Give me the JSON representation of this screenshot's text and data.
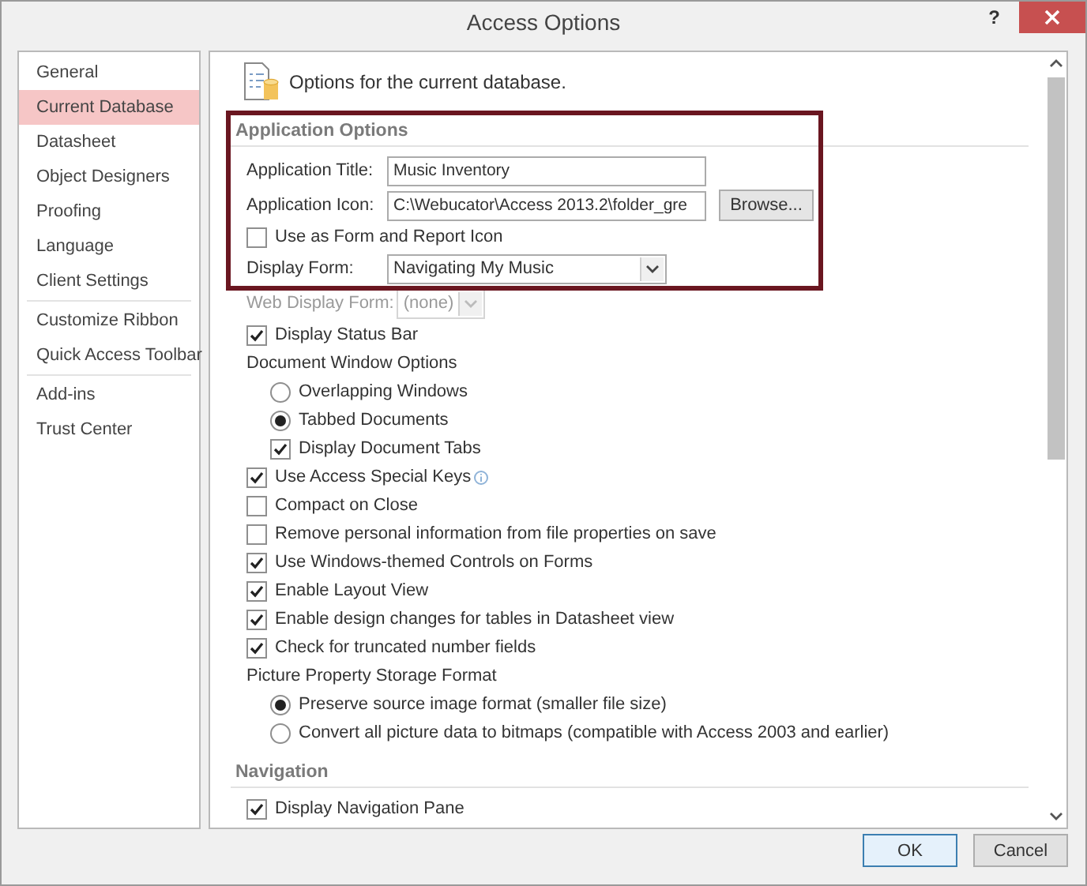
{
  "window": {
    "title": "Access Options",
    "help": "?"
  },
  "sidebar": {
    "groups": [
      {
        "items": [
          {
            "label": "General",
            "selected": false
          },
          {
            "label": "Current Database",
            "selected": true
          },
          {
            "label": "Datasheet",
            "selected": false
          },
          {
            "label": "Object Designers",
            "selected": false
          },
          {
            "label": "Proofing",
            "selected": false
          },
          {
            "label": "Language",
            "selected": false
          },
          {
            "label": "Client Settings",
            "selected": false
          }
        ]
      },
      {
        "items": [
          {
            "label": "Customize Ribbon",
            "selected": false
          },
          {
            "label": "Quick Access Toolbar",
            "selected": false
          }
        ]
      },
      {
        "items": [
          {
            "label": "Add-ins",
            "selected": false
          },
          {
            "label": "Trust Center",
            "selected": false
          }
        ]
      }
    ]
  },
  "content": {
    "header": "Options for the current database.",
    "sections": [
      {
        "title": "Application Options",
        "highlighted": true,
        "rows": [
          {
            "kind": "text_field",
            "label": "Application Title:",
            "value": "Music Inventory"
          },
          {
            "kind": "file_field",
            "label": "Application Icon:",
            "value": "C:\\Webucator\\Access 2013.2\\folder_gre",
            "button": "Browse..."
          },
          {
            "kind": "checkbox",
            "label": "Use as Form and Report Icon",
            "checked": false
          },
          {
            "kind": "dropdown",
            "label": "Display Form:",
            "value": "Navigating My Music",
            "disabled": false
          },
          {
            "kind": "dropdown",
            "label": "Web Display Form:",
            "value": "(none)",
            "disabled": true
          },
          {
            "kind": "checkbox",
            "label": "Display Status Bar",
            "checked": true
          },
          {
            "kind": "group",
            "label": "Document Window Options",
            "children": [
              {
                "kind": "radio",
                "label": "Overlapping Windows",
                "selected": false
              },
              {
                "kind": "radio",
                "label": "Tabbed Documents",
                "selected": true
              },
              {
                "kind": "checkbox",
                "label": "Display Document Tabs",
                "checked": true
              }
            ]
          },
          {
            "kind": "checkbox",
            "label": "Use Access Special Keys",
            "checked": true,
            "info": true
          },
          {
            "kind": "checkbox",
            "label": "Compact on Close",
            "checked": false
          },
          {
            "kind": "checkbox",
            "label": "Remove personal information from file properties on save",
            "checked": false
          },
          {
            "kind": "checkbox",
            "label": "Use Windows-themed Controls on Forms",
            "checked": true
          },
          {
            "kind": "checkbox",
            "label": "Enable Layout View",
            "checked": true
          },
          {
            "kind": "checkbox",
            "label": "Enable design changes for tables in Datasheet view",
            "checked": true
          },
          {
            "kind": "checkbox",
            "label": "Check for truncated number fields",
            "checked": true
          },
          {
            "kind": "group",
            "label": "Picture Property Storage Format",
            "children": [
              {
                "kind": "radio",
                "label": "Preserve source image format (smaller file size)",
                "selected": true
              },
              {
                "kind": "radio",
                "label": "Convert all picture data to bitmaps (compatible with Access 2003 and earlier)",
                "selected": false
              }
            ]
          }
        ]
      },
      {
        "title": "Navigation",
        "rows": [
          {
            "kind": "checkbox",
            "label": "Display Navigation Pane",
            "checked": true
          }
        ]
      }
    ]
  },
  "buttons": [
    {
      "label": "OK",
      "default": true
    },
    {
      "label": "Cancel",
      "default": false
    }
  ]
}
